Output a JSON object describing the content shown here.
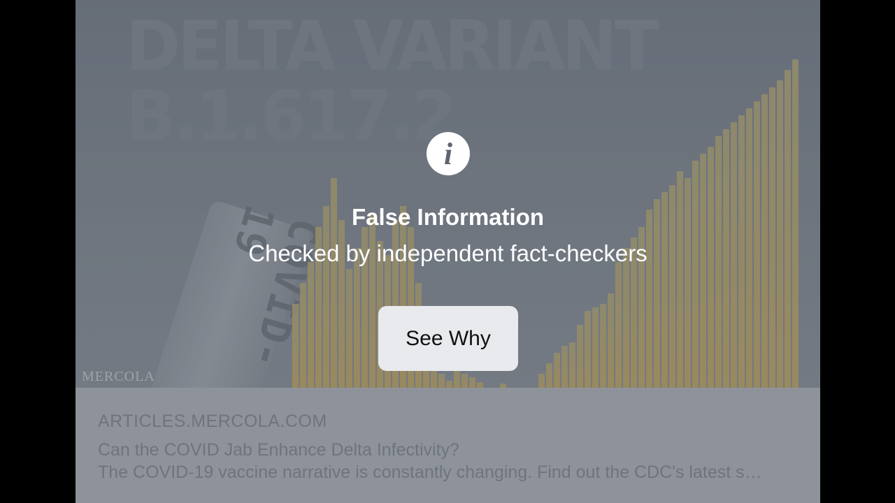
{
  "background_image": {
    "line1": "DELTA VARIANT",
    "line2": "B.1.617.2",
    "vial_label": "COVID-19",
    "watermark": "MERCOLA"
  },
  "alert": {
    "icon": "info-icon",
    "title": "False Information",
    "subtitle": "Checked by independent fact-checkers",
    "button_label": "See Why"
  },
  "link_preview": {
    "domain": "ARTICLES.MERCOLA.COM",
    "headline": "Can the COVID Jab Enhance Delta Infectivity?",
    "description": "The COVID-19 vaccine narrative is constantly changing. Find out the CDC's latest s…"
  },
  "colors": {
    "letterbox": "#000000",
    "overlay": "#6a717b",
    "button_bg": "#e9eaed",
    "bar_color": "#b79a52",
    "link_panel": "#8e939b"
  }
}
